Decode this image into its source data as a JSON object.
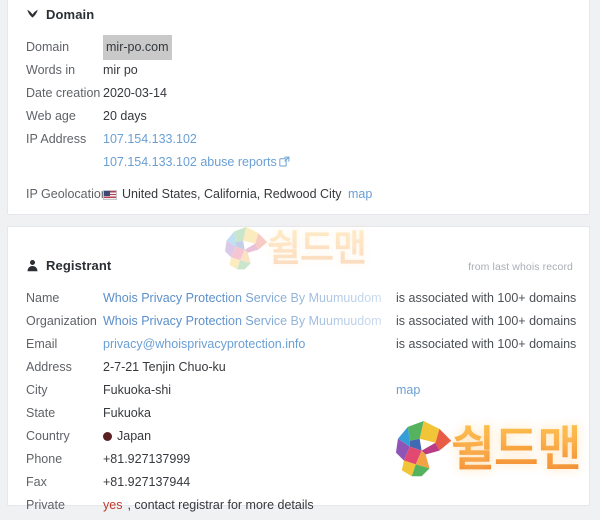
{
  "colors": {
    "page_bg": "#f0f1f3",
    "card_bg": "#ffffff",
    "label": "#5f6368",
    "value": "#36393d",
    "link": "#6a9fd4",
    "danger": "#c0392b",
    "highlight": "#c9c9c9",
    "watermark_orange": "#f79a2a"
  },
  "domain_section": {
    "icon": "shield-icon",
    "title": "Domain",
    "rows": [
      {
        "label": "Domain",
        "value": "mir-po.com",
        "style": "highlight"
      },
      {
        "label": "Words in",
        "value": "mir po",
        "style": "plain"
      },
      {
        "label": "Date creation",
        "value": "2020-03-14",
        "style": "plain"
      },
      {
        "label": "Web age",
        "value": "20 days",
        "style": "plain"
      },
      {
        "label": "IP Address",
        "value": "107.154.133.102",
        "style": "link"
      }
    ],
    "abuse_reports": {
      "label": "107.154.133.102 abuse reports",
      "icon": "external-link-icon"
    },
    "geolocation": {
      "label": "IP Geolocation",
      "flag": "flag-us-icon",
      "value": "United States, California, Redwood City",
      "map_link": "map"
    }
  },
  "registrant_section": {
    "icon": "user-icon",
    "title": "Registrant",
    "note": "from last whois record",
    "assoc_text": "is associated with 100+ domains",
    "rows": [
      {
        "label": "Name",
        "value": "Whois Privacy Protection Service By Muumuudomain",
        "style": "fade-link",
        "assoc": true
      },
      {
        "label": "Organization",
        "value": "Whois Privacy Protection Service By Muumuudomain",
        "style": "fade-link",
        "assoc": true
      },
      {
        "label": "Email",
        "value": "privacy@whoisprivacyprotection.info",
        "style": "link",
        "assoc": true
      },
      {
        "label": "Address",
        "value": "2-7-21 Tenjin Chuo-ku",
        "style": "plain",
        "assoc": false
      },
      {
        "label": "City",
        "value": "Fukuoka-shi",
        "style": "plain",
        "assoc": false,
        "map_link": "map"
      },
      {
        "label": "State",
        "value": "Fukuoka",
        "style": "plain",
        "assoc": false
      },
      {
        "label": "Country",
        "value": "Japan",
        "style": "flag-jp",
        "assoc": false
      },
      {
        "label": "Phone",
        "value": "+81.927137999",
        "style": "plain",
        "assoc": false
      },
      {
        "label": "Fax",
        "value": "+81.927137944",
        "style": "plain",
        "assoc": false
      }
    ],
    "private_row": {
      "label": "Private",
      "emphasis": "yes",
      "rest": ", contact registrar for more details"
    }
  },
  "watermark": {
    "text": "쉴드맨",
    "logo": "shieldman-s-logo"
  }
}
